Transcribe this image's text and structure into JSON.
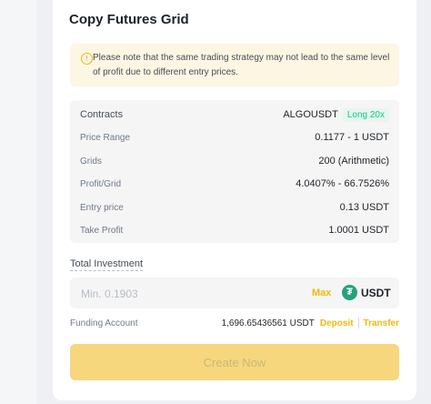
{
  "title": "Copy Futures Grid",
  "notice": {
    "icon": "info-circle-icon",
    "text": "Please note that the same trading strategy may not lead to the same level of profit due to different entry prices."
  },
  "details": {
    "contracts_label": "Contracts",
    "contracts_value": "ALGOUSDT",
    "contracts_badge": "Long 20x",
    "price_range_label": "Price Range",
    "price_range_value": "0.1177 - 1 USDT",
    "grids_label": "Grids",
    "grids_value": "200 (Arithmetic)",
    "profit_label": "Profit/Grid",
    "profit_value": "4.0407% - 66.7526%",
    "entry_label": "Entry price",
    "entry_value": "0.13 USDT",
    "tp_label": "Take Profit",
    "tp_value": "1.0001 USDT"
  },
  "investment": {
    "label": "Total Investment",
    "placeholder": "Min. 0.1903",
    "max_label": "Max",
    "coin_icon": "tether-icon",
    "coin": "USDT"
  },
  "funding": {
    "label": "Funding Account",
    "amount": "1,696.65436561 USDT",
    "deposit": "Deposit",
    "transfer": "Transfer"
  },
  "button": {
    "label": "Create Now"
  },
  "colors": {
    "accent": "#f0b90b",
    "badge_green": "#0ecb81",
    "usdt_green": "#26a17b",
    "button_disabled": "#f6d77d"
  }
}
